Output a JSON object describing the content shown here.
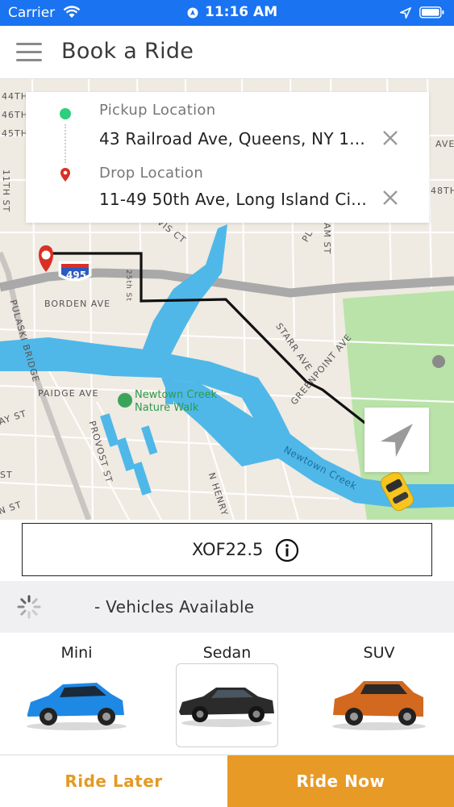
{
  "status_bar": {
    "carrier": "Carrier",
    "time": "11:16 AM"
  },
  "header": {
    "title": "Book a Ride",
    "menu_icon": "hamburger-menu-icon"
  },
  "location_card": {
    "pickup_label": "Pickup Location",
    "pickup_value": "43 Railroad Ave, Queens, NY 1...",
    "drop_label": "Drop Location",
    "drop_value": "11-49 50th Ave, Long Island Ci...",
    "pickup_dot_color": "#2ecf7c",
    "drop_pin_color": "#d93025"
  },
  "map": {
    "labels": {
      "l44th": "44TH",
      "l46th": "46TH",
      "l45th": "45TH",
      "l11th": "11TH ST",
      "ave_r": "AVE",
      "l48th": "48TH",
      "vis_ct": "VIS CT",
      "l25th": "25th St",
      "pl": "PL",
      "am_st": "AM ST",
      "borden": "BORDEN AVE",
      "pulaski": "PULASKI BRIDGE",
      "starr": "STARR AVE",
      "greenpoint": "GREENPOINT AVE",
      "paidge": "PAIDGE AVE",
      "ay_st": "AY ST",
      "provost": "PROVOST ST",
      "st": "ST",
      "n_st": "N ST",
      "henry": "N HENRY",
      "interstate": "495",
      "park_name": "Newtown Creek Nature Walk",
      "creek": "Newtown Creek"
    }
  },
  "fare": {
    "amount": "XOF22.5",
    "info_icon": "info-icon"
  },
  "availability": {
    "text": "- Vehicles Available"
  },
  "vehicles": [
    {
      "name": "Mini",
      "color": "#1e88e5"
    },
    {
      "name": "Sedan",
      "color": "#2b2b2b"
    },
    {
      "name": "SUV",
      "color": "#d2691e"
    }
  ],
  "selected_vehicle": "Sedan",
  "actions": {
    "ride_later": "Ride Later",
    "ride_now": "Ride Now"
  },
  "colors": {
    "status_bar": "#1a73f0",
    "accent": "#e89a26",
    "water": "#4fb8e8",
    "park": "#b9e3a8"
  }
}
